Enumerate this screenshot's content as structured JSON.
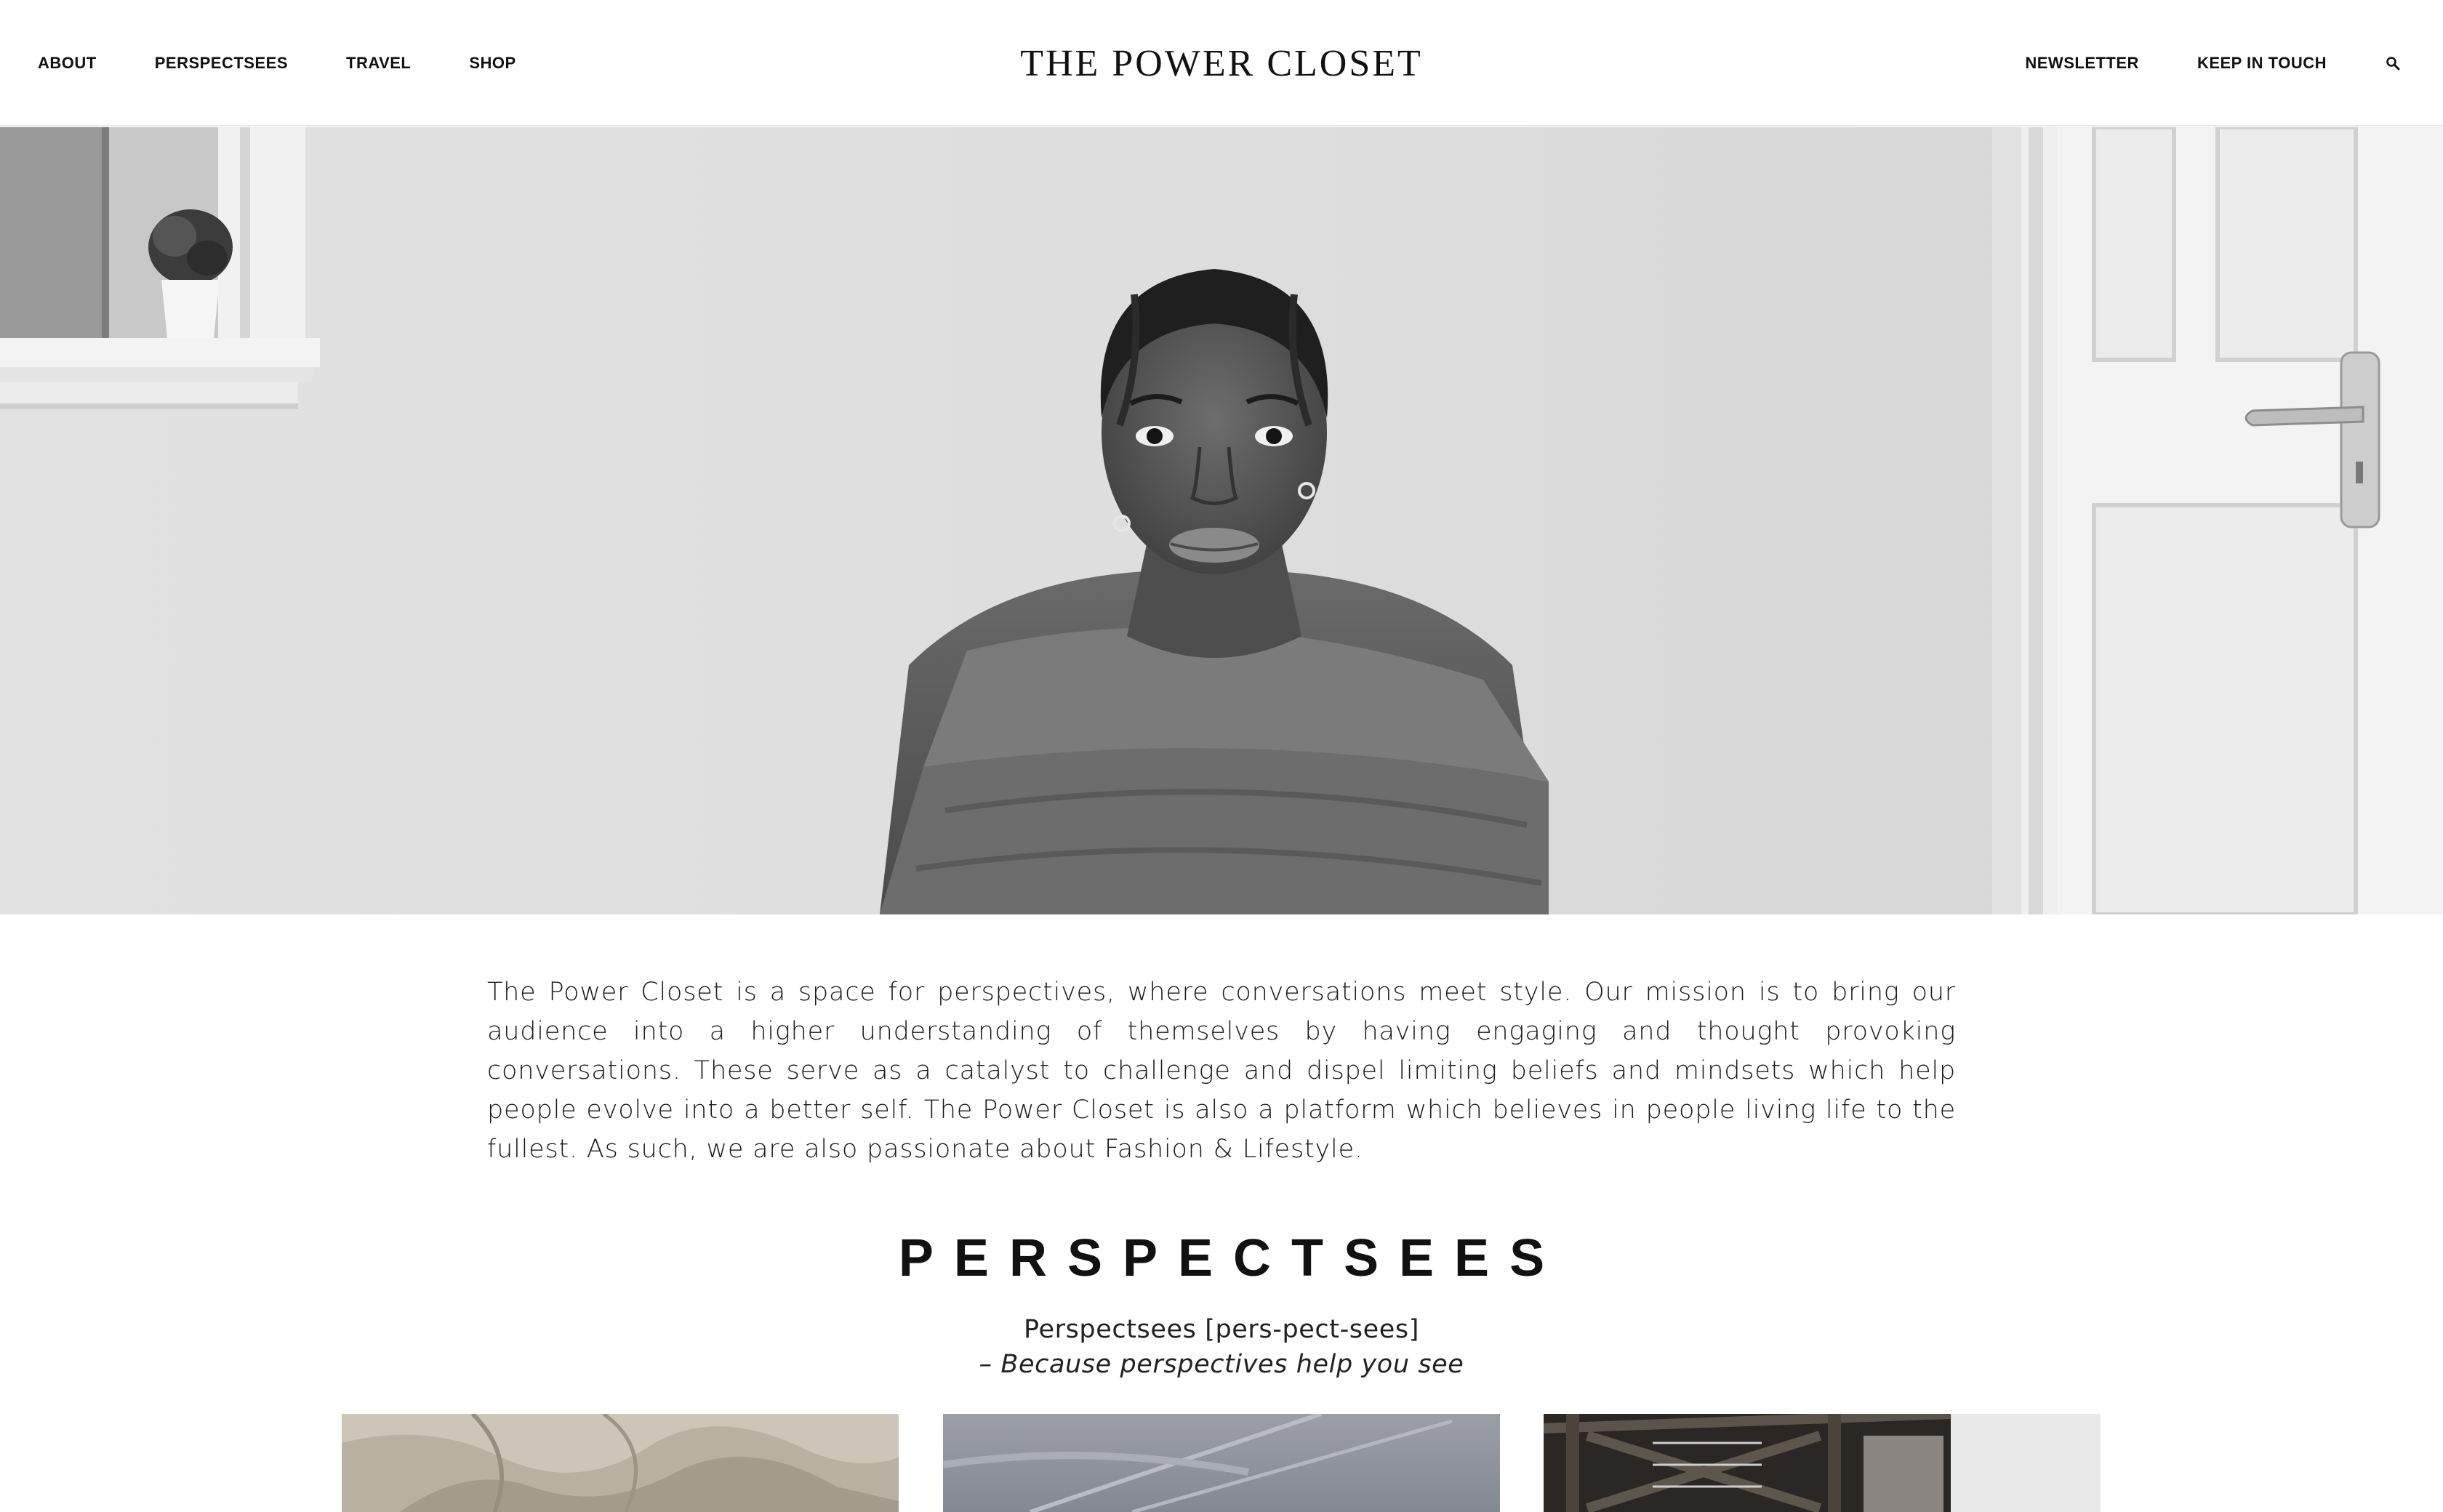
{
  "header": {
    "logo": "THE POWER CLOSET",
    "nav_left": [
      "ABOUT",
      "PERSPECTSEES",
      "TRAVEL",
      "SHOP"
    ],
    "nav_right": [
      "NEWSLETTER",
      "KEEP IN TOUCH"
    ],
    "search_icon": "search-icon"
  },
  "intro": {
    "text": "The Power Closet is a space for perspectives, where conversations meet style. Our mission is to bring our audience into a higher understanding of themselves by having engaging and thought provoking conversations. These serve as a catalyst to challenge and dispel limiting beliefs and mindsets which help people evolve into a better self. The Power Closet is also a platform which believes in people living life to the fullest. As such, we are also passionate about Fashion & Lifestyle."
  },
  "perspectsees": {
    "title": "PERSPECTSEES",
    "definition": "Perspectsees [pers-pect-sees]",
    "tagline": "– Because perspectives help you see"
  },
  "colors": {
    "text": "#111111",
    "background": "#ffffff",
    "hero_wall": "#dcdcdc"
  }
}
